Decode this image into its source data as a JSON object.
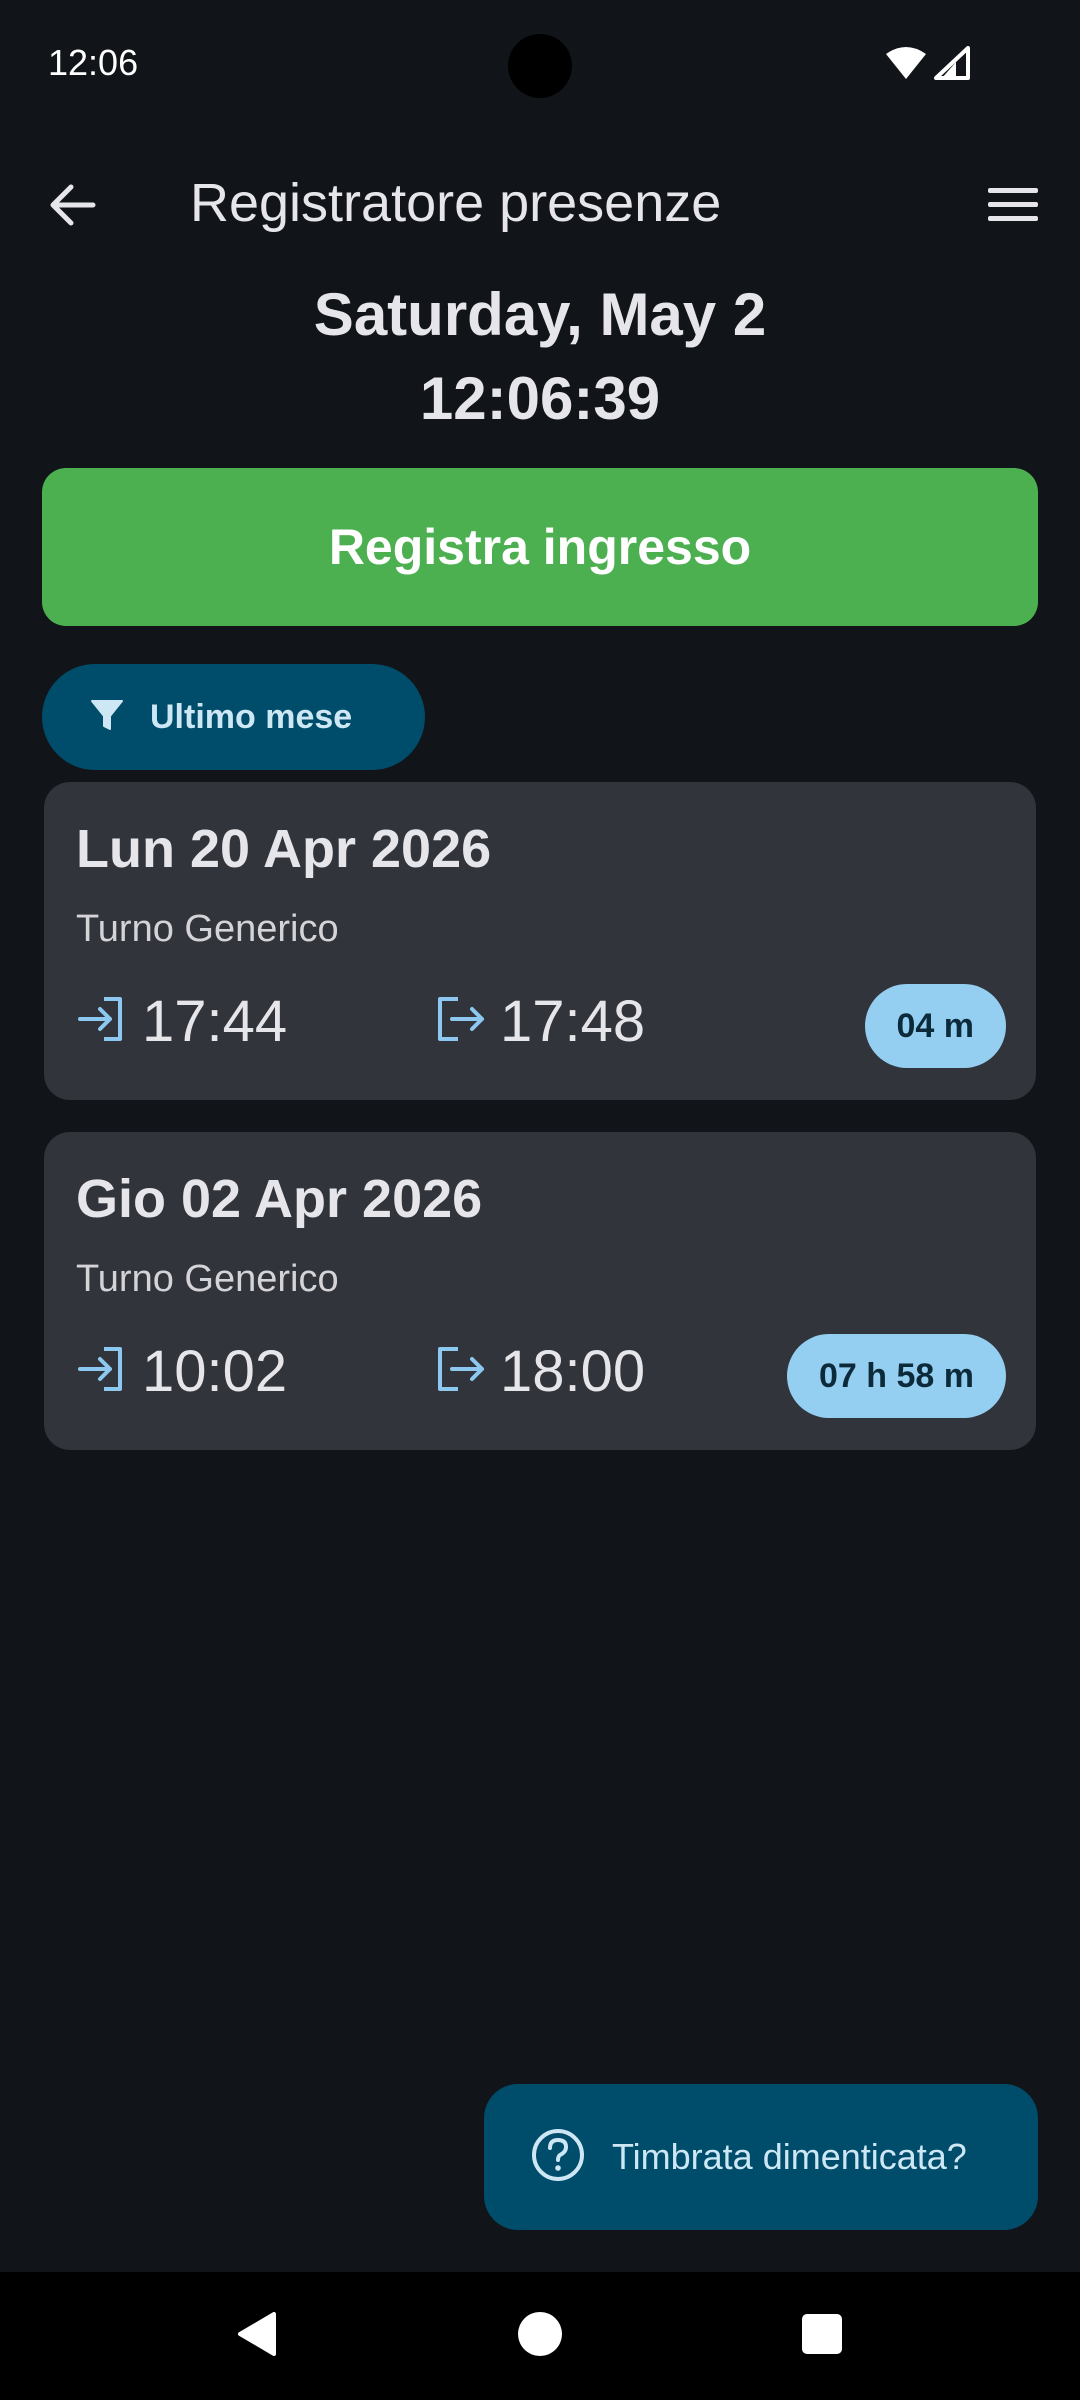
{
  "status_bar": {
    "time": "12:06"
  },
  "app_bar": {
    "title": "Registratore presenze",
    "back_icon": "arrow-left-icon",
    "menu_icon": "hamburger-menu-icon"
  },
  "header": {
    "date": "Saturday, May 2",
    "clock": "12:06:39"
  },
  "primary_action": {
    "label": "Registra ingresso",
    "color": "#4caf50"
  },
  "filter": {
    "label": "Ultimo mese",
    "icon": "filter-funnel-icon"
  },
  "entries": [
    {
      "date": "Lun 20 Apr 2026",
      "shift": "Turno Generico",
      "clock_in": "17:44",
      "clock_out": "17:48",
      "duration": "04 m"
    },
    {
      "date": "Gio 02 Apr 2026",
      "shift": "Turno Generico",
      "clock_in": "10:02",
      "clock_out": "18:00",
      "duration": "07 h 58 m"
    }
  ],
  "fab": {
    "label": "Timbrata dimenticata?",
    "icon": "help-circle-icon"
  },
  "colors": {
    "background": "#111418",
    "card": "#31343a",
    "accent_blue": "#94cff2",
    "chip_bg": "#004c6b"
  },
  "nav": {
    "back_icon": "nav-back-icon",
    "home_icon": "nav-home-icon",
    "recents_icon": "nav-recents-icon"
  }
}
